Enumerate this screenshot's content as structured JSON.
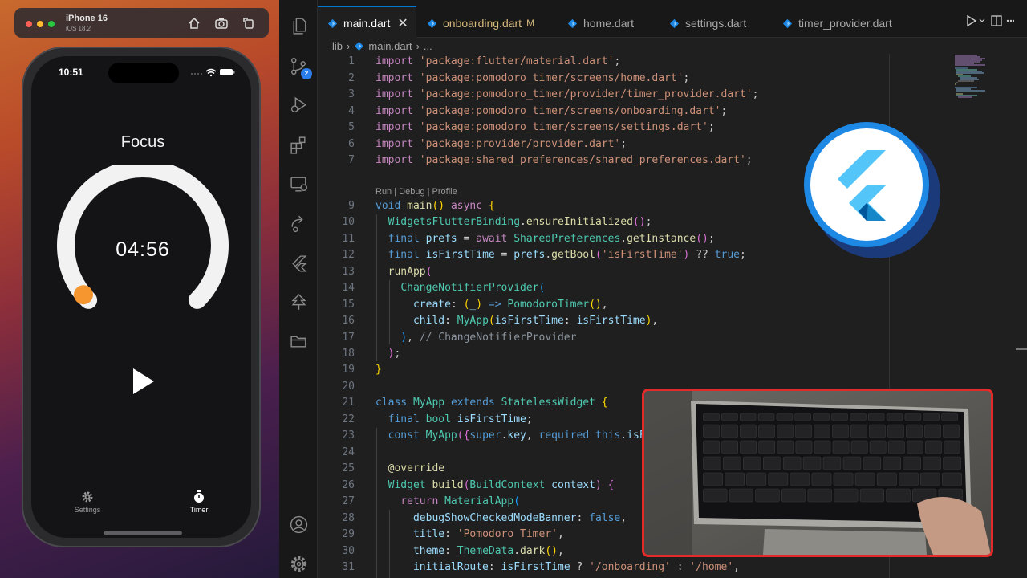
{
  "simulator": {
    "device_name": "iPhone 16",
    "os_version": "iOS 18.2",
    "status_time": "10:51",
    "app": {
      "mode_label": "Focus",
      "timer_display": "04:56",
      "progress_remaining_fraction": 0.98,
      "accent_color": "#f5962e",
      "tabs": [
        {
          "label": "Settings",
          "icon": "gear-icon",
          "active": false
        },
        {
          "label": "Timer",
          "icon": "stopwatch-icon",
          "active": true
        }
      ]
    }
  },
  "editor": {
    "tabs": [
      {
        "label": "main.dart",
        "active": true,
        "modified": false
      },
      {
        "label": "onboarding.dart",
        "active": false,
        "modified": true,
        "modified_marker": "M"
      },
      {
        "label": "home.dart",
        "active": false,
        "modified": false
      },
      {
        "label": "settings.dart",
        "active": false,
        "modified": false
      },
      {
        "label": "timer_provider.dart",
        "active": false,
        "modified": false
      }
    ],
    "close_glyph": "✕",
    "breadcrumb": {
      "folder": "lib",
      "file": "main.dart",
      "rest": "..."
    },
    "scm_badge": "2",
    "codelens": "Run | Debug | Profile",
    "line_numbers": [
      "1",
      "2",
      "3",
      "4",
      "5",
      "6",
      "7",
      "9",
      "10",
      "11",
      "12",
      "13",
      "14",
      "15",
      "16",
      "17",
      "18",
      "19",
      "20",
      "21",
      "22",
      "23",
      "24",
      "25",
      "26",
      "27",
      "28",
      "29",
      "30",
      "31"
    ],
    "code": {
      "l1_kw": "import",
      "l1_str": "'package:flutter/material.dart'",
      "l2_kw": "import",
      "l2_str": "'package:pomodoro_timer/screens/home.dart'",
      "l3_kw": "import",
      "l3_str": "'package:pomodoro_timer/provider/timer_provider.dart'",
      "l4_kw": "import",
      "l4_str": "'package:pomodoro_timer/screens/onboarding.dart'",
      "l5_kw": "import",
      "l5_str": "'package:pomodoro_timer/screens/settings.dart'",
      "l6_kw": "import",
      "l6_str": "'package:provider/provider.dart'",
      "l7_kw": "import",
      "l7_str": "'package:shared_preferences/shared_preferences.dart'",
      "semi": ";",
      "void": "void",
      "main": "main",
      "async": "async",
      "wfb": "WidgetsFlutterBinding",
      "ensure": "ensureInitialized",
      "final": "final",
      "prefs": "prefs",
      "await": "await",
      "sp": "SharedPreferences",
      "getinst": "getInstance",
      "isFirstTime": "isFirstTime",
      "getBool": "getBool",
      "iftkey": "'isFirstTime'",
      "qq": "??",
      "true": "true",
      "runApp": "runApp",
      "cnp": "ChangeNotifierProvider",
      "create": "create",
      "underscore": "_",
      "arrow": "=>",
      "pt": "PomodoroTimer",
      "child": "child",
      "myapp": "MyApp",
      "comment_cnp": "// ChangeNotifierProvider",
      "class": "class",
      "extends": "extends",
      "sw": "StatelessWidget",
      "bool": "bool",
      "const": "const",
      "super": "super",
      "key": "key",
      "required": "required",
      "this": "this",
      "override": "@override",
      "widget": "Widget",
      "build": "build",
      "bc": "BuildContext",
      "context": "context",
      "return": "return",
      "materialApp": "MaterialApp",
      "debugBanner": "debugShowCheckedModeBanner",
      "false": "false",
      "title": "title",
      "titleStr": "'Pomodoro Timer'",
      "theme": "theme",
      "themeData": "ThemeData",
      "dark": "dark",
      "initialRoute": "initialRoute",
      "q": "?",
      "onb": "'/onboarding'",
      "colon": ":",
      "home": "'/home'"
    }
  },
  "colors": {
    "accent_blue": "#0078d4",
    "flutter_blue": "#1e88e5",
    "webcam_border": "#e32a2a"
  }
}
